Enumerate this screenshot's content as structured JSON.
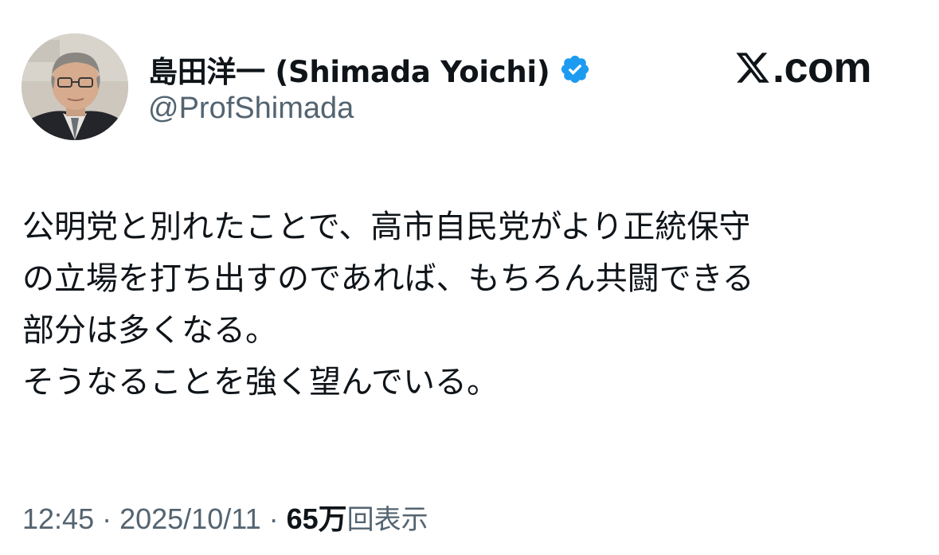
{
  "author": {
    "display_name": "島田洋一 (Shimada Yoichi)",
    "handle": "@ProfShimada",
    "verified_color": "#1d9bf0",
    "avatar_icon": "person-photo-avatar"
  },
  "brand": {
    "logo_icon": "x-logo-icon",
    "suffix": ".com"
  },
  "tweet": {
    "lines": [
      "公明党と別れたことで、高市自民党がより正統保守",
      "の立場を打ち出すのであれば、もちろん共闘できる",
      "部分は多くなる。",
      "そうなることを強く望んでいる。"
    ]
  },
  "meta": {
    "time": "12:45",
    "separator": "·",
    "date": "2025/10/11",
    "views_count": "65万",
    "views_label": "回表示"
  },
  "colors": {
    "text_primary": "#0f1419",
    "text_secondary": "#536471"
  }
}
